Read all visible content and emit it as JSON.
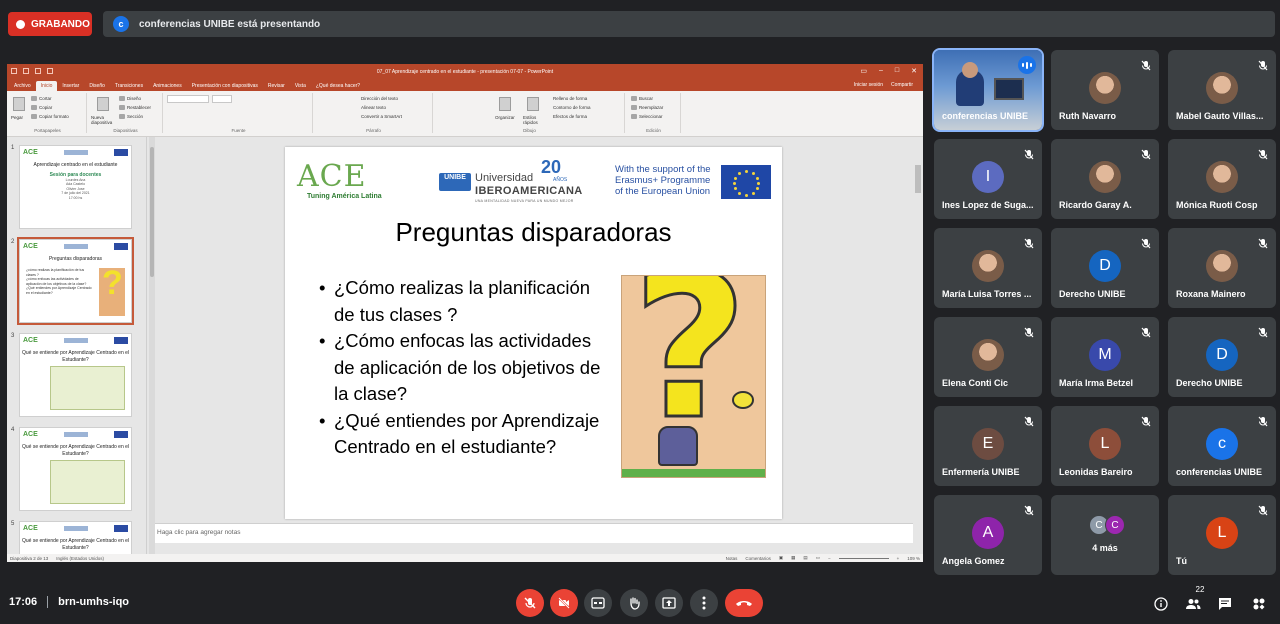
{
  "top": {
    "recording_label": "GRABANDO",
    "presenter_initial": "c",
    "presenting_text": "conferencias UNIBE está presentando"
  },
  "ppt": {
    "window_title": "07_07 Aprendizaje centrado en el estudiante - presentación 07-07 - PowerPoint",
    "tabs": [
      "Archivo",
      "Inicio",
      "Insertar",
      "Diseño",
      "Transiciones",
      "Animaciones",
      "Presentación con diapositivas",
      "Revisar",
      "Vista",
      "¿Qué desea hacer?"
    ],
    "signin": "Iniciar sesión",
    "share": "Compartir",
    "ribbon": {
      "paste": "Pegar",
      "cut": "Cortar",
      "copy": "Copiar",
      "format_painter": "Copiar formato",
      "clipboard": "Portapapeles",
      "new_slide": "Nueva diapositiva",
      "layout": "Diseño",
      "reset": "Restablecer",
      "section": "Sección",
      "slides": "Diapositivas",
      "font": "Fuente",
      "paragraph": "Párrafo",
      "text_direction": "Dirección del texto",
      "align_text": "Alinear texto",
      "smartart": "Convertir a SmartArt",
      "arrange": "Organizar",
      "quick_styles": "Estilos rápidos",
      "shape_fill": "Relleno de forma",
      "shape_outline": "Contorno de forma",
      "shape_effects": "Efectos de forma",
      "drawing": "Dibujo",
      "find": "Buscar",
      "replace": "Reemplazar",
      "select": "Seleccionar",
      "editing": "Edición"
    },
    "thumbnails": [
      {
        "num": "1",
        "title": "Aprendizaje centrado en el estudiante",
        "sub": "Sesión para docentes",
        "small": [
          "Lourdes Ana",
          "Ada Castelo",
          "Olivier Jose",
          "7 de julio del 2021",
          "17:00 hs"
        ]
      },
      {
        "num": "2",
        "title": "Preguntas disparadoras",
        "bullets": [
          "¿cómo realizas la planificación de tus clases ?",
          "¿cómo enfocas las actividades de aplicación de los objetivos de la clase?",
          "¿Qué entiendes por Aprendizaje Centrado en el estudiante?"
        ]
      },
      {
        "num": "3",
        "title": "Qué se entiende por Aprendizaje Centrado en el Estudiante?"
      },
      {
        "num": "4",
        "title": "Qué se entiende por Aprendizaje Centrado en el Estudiante?"
      },
      {
        "num": "5",
        "title": "Qué se entiende por Aprendizaje Centrado en el Estudiante?"
      }
    ],
    "slide": {
      "logo_ace": "ACE",
      "logo_ace_sub": "Tuning América Latina",
      "unibe_box": "UNIBE",
      "unibe_line1": "Universidad",
      "unibe_line2": "IBEROAMERICANA",
      "unibe_20": "20",
      "unibe_anos": "AÑOS",
      "unibe_tag": "UNA MENTALIDAD NUEVA PARA UN MUNDO MEJOR",
      "erasmus_text": "With the support of the Erasmus+ Programme of the European Union",
      "title": "Preguntas disparadoras",
      "bullets": [
        "¿Cómo realizas la planificación de tus clases ?",
        "¿Cómo enfocas las actividades de aplicación de los objetivos de la clase?",
        "¿Qué entiendes por Aprendizaje Centrado en el estudiante?"
      ]
    },
    "notes_placeholder": "Haga clic para agregar notas",
    "status": {
      "slide_info": "Diapositiva 2 de 13",
      "language": "Inglés (Estados Unidos)",
      "notes": "Notas",
      "comments": "Comentarios",
      "zoom": "109 %"
    }
  },
  "participants": [
    {
      "name": "conferencias UNIBE",
      "type": "video",
      "speaking": true
    },
    {
      "name": "Ruth Navarro",
      "type": "photo"
    },
    {
      "name": "Mabel Gauto Villas...",
      "type": "photo"
    },
    {
      "name": "Ines Lopez de Suga...",
      "type": "letter",
      "letter": "I",
      "color": "#5c6bc0"
    },
    {
      "name": "Ricardo Garay A.",
      "type": "photo"
    },
    {
      "name": "Mónica Ruoti Cosp",
      "type": "photo"
    },
    {
      "name": "María Luisa Torres ...",
      "type": "photo"
    },
    {
      "name": "Derecho UNIBE",
      "type": "letter",
      "letter": "D",
      "color": "#1565c0"
    },
    {
      "name": "Roxana Mainero",
      "type": "photo"
    },
    {
      "name": "Elena Conti Cic",
      "type": "photo"
    },
    {
      "name": "María Irma Betzel",
      "type": "letter",
      "letter": "M",
      "color": "#3949ab"
    },
    {
      "name": "Derecho UNIBE",
      "type": "letter",
      "letter": "D",
      "color": "#1565c0"
    },
    {
      "name": "Enfermería UNIBE",
      "type": "letter",
      "letter": "E",
      "color": "#6d4c41"
    },
    {
      "name": "Leonidas Bareiro",
      "type": "letter",
      "letter": "L",
      "color": "#8d4e3a"
    },
    {
      "name": "conferencias UNIBE",
      "type": "letter",
      "letter": "c",
      "color": "#1a73e8"
    },
    {
      "name": "Angela Gomez",
      "type": "letter",
      "letter": "A",
      "color": "#8e24aa"
    },
    {
      "name": "4 más",
      "type": "more",
      "letters": [
        "C",
        "C"
      ]
    },
    {
      "name": "Tú",
      "type": "letter",
      "letter": "L",
      "color": "#d84315"
    }
  ],
  "bottom": {
    "time": "17:06",
    "meeting_code": "brn-umhs-iqo",
    "participant_count": "22"
  },
  "colors": {
    "ppt_accent": "#b7472a",
    "meet_bg": "#202124",
    "tile_bg": "#3c4043",
    "danger": "#ea4335"
  }
}
